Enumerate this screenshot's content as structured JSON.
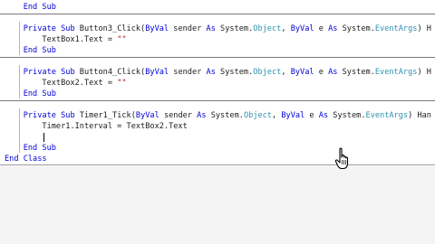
{
  "code": {
    "lines": [
      [
        {
          "t": "    "
        },
        {
          "t": "End Sub",
          "c": "kw"
        }
      ],
      [],
      [
        {
          "t": "    "
        },
        {
          "t": "Private Sub",
          "c": "kw"
        },
        {
          "t": " Button3_Click("
        },
        {
          "t": "ByVal",
          "c": "kw"
        },
        {
          "t": " sender "
        },
        {
          "t": "As",
          "c": "kw"
        },
        {
          "t": " System."
        },
        {
          "t": "Object",
          "c": "ty"
        },
        {
          "t": ", "
        },
        {
          "t": "ByVal",
          "c": "kw"
        },
        {
          "t": " e "
        },
        {
          "t": "As",
          "c": "kw"
        },
        {
          "t": " System."
        },
        {
          "t": "EventArgs",
          "c": "ty"
        },
        {
          "t": ") H"
        }
      ],
      [
        {
          "t": "        TextBox1.Text = "
        },
        {
          "t": "\"\"",
          "c": "str"
        }
      ],
      [
        {
          "t": "    "
        },
        {
          "t": "End Sub",
          "c": "kw"
        }
      ],
      [],
      [
        {
          "t": "    "
        },
        {
          "t": "Private Sub",
          "c": "kw"
        },
        {
          "t": " Button4_Click("
        },
        {
          "t": "ByVal",
          "c": "kw"
        },
        {
          "t": " sender "
        },
        {
          "t": "As",
          "c": "kw"
        },
        {
          "t": " System."
        },
        {
          "t": "Object",
          "c": "ty"
        },
        {
          "t": ", "
        },
        {
          "t": "ByVal",
          "c": "kw"
        },
        {
          "t": " e "
        },
        {
          "t": "As",
          "c": "kw"
        },
        {
          "t": " System."
        },
        {
          "t": "EventArgs",
          "c": "ty"
        },
        {
          "t": ") H"
        }
      ],
      [
        {
          "t": "        TextBox2.Text = "
        },
        {
          "t": "\"\"",
          "c": "str"
        }
      ],
      [
        {
          "t": "    "
        },
        {
          "t": "End Sub",
          "c": "kw"
        }
      ],
      [],
      [
        {
          "t": "    "
        },
        {
          "t": "Private Sub",
          "c": "kw"
        },
        {
          "t": " Timer1_Tick("
        },
        {
          "t": "ByVal",
          "c": "kw"
        },
        {
          "t": " sender "
        },
        {
          "t": "As",
          "c": "kw"
        },
        {
          "t": " System."
        },
        {
          "t": "Object",
          "c": "ty"
        },
        {
          "t": ", "
        },
        {
          "t": "ByVal",
          "c": "kw"
        },
        {
          "t": " e "
        },
        {
          "t": "As",
          "c": "kw"
        },
        {
          "t": " System."
        },
        {
          "t": "EventArgs",
          "c": "ty"
        },
        {
          "t": ") Han"
        }
      ],
      [
        {
          "t": "        Timer1.Interval = TextBox2.Text"
        }
      ],
      [],
      [
        {
          "t": "    "
        },
        {
          "t": "End Sub",
          "c": "kw"
        }
      ],
      [
        {
          "t": "End Class",
          "c": "kw"
        }
      ]
    ]
  },
  "icons": {
    "pointer": "hand-pointer-icon"
  },
  "colors": {
    "keyword": "#0000d8",
    "type": "#2b91af",
    "string": "#a31515",
    "separator": "#7a7a7a"
  }
}
